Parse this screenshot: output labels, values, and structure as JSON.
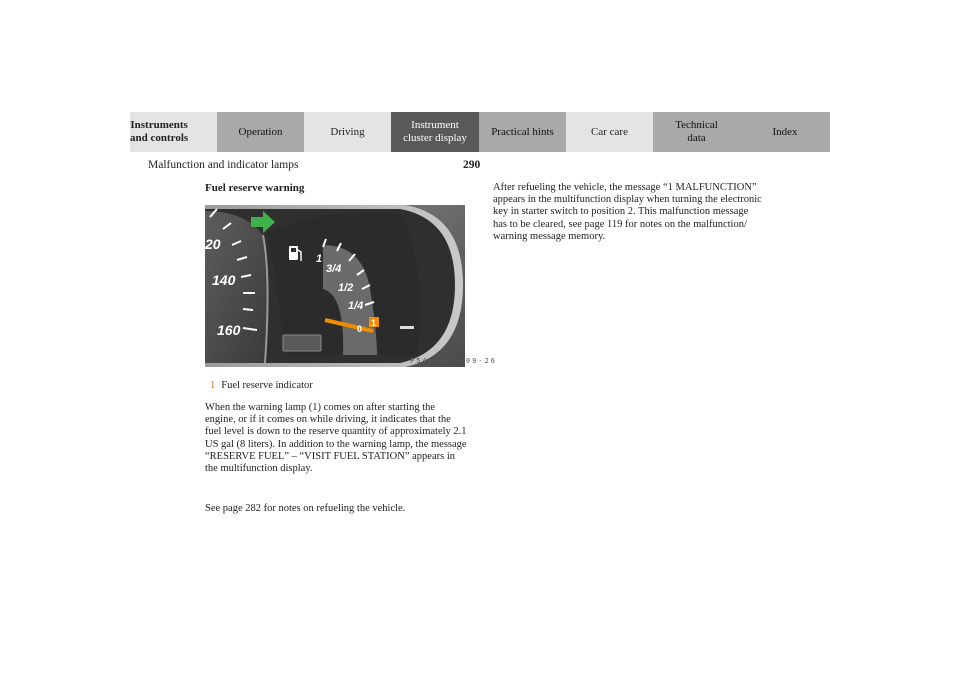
{
  "nav": {
    "tabs": [
      {
        "label": "Instruments\nand controls"
      },
      {
        "label": "Operation"
      },
      {
        "label": "Driving"
      },
      {
        "label": "Instrument\ncluster display"
      },
      {
        "label": "Practical hints"
      },
      {
        "label": "Car care"
      },
      {
        "label": "Technical\ndata"
      },
      {
        "label": "Index"
      }
    ]
  },
  "header": {
    "section": "Malfunction and indicator lamps",
    "page_number": "290"
  },
  "left": {
    "subheading": "Fuel reserve warning",
    "figure_code": "P54.30-3609-26",
    "gauge_labels": {
      "speed_120": "20",
      "speed_140": "140",
      "speed_160": "160",
      "fuel_full": "1",
      "fuel_3_4": "3/4",
      "fuel_1_2": "1/2",
      "fuel_1_4": "1/4",
      "fuel_empty": "0",
      "callout": "1"
    },
    "legend_number": "1",
    "legend_text": "Fuel reserve indicator",
    "paragraph1": "When the warning lamp (1) comes on after starting the engine, or if it comes on while driving, it indicates that the fuel level is down to the reserve quantity of approximately 2.1 US gal (8 liters). In addition to the warning lamp, the message “RESERVE FUEL” – “VISIT FUEL STATION” appears in the multifunction display.",
    "paragraph2": "See page 282 for notes on refueling the vehicle."
  },
  "right": {
    "paragraph": "After refueling the vehicle, the message “1 MALFUNCTION” appears in the multifunction display when turning the electronic key in starter switch to position 2. This malfunction message has to be cleared, see page 119 for notes on the malfunction/ warning message memory."
  },
  "colors": {
    "tab_light": "#e4e4e4",
    "tab_mid": "#a9a9a9",
    "tab_dark": "#595959",
    "accent_orange": "#f08c00",
    "green_arrow": "#3fb04a"
  }
}
